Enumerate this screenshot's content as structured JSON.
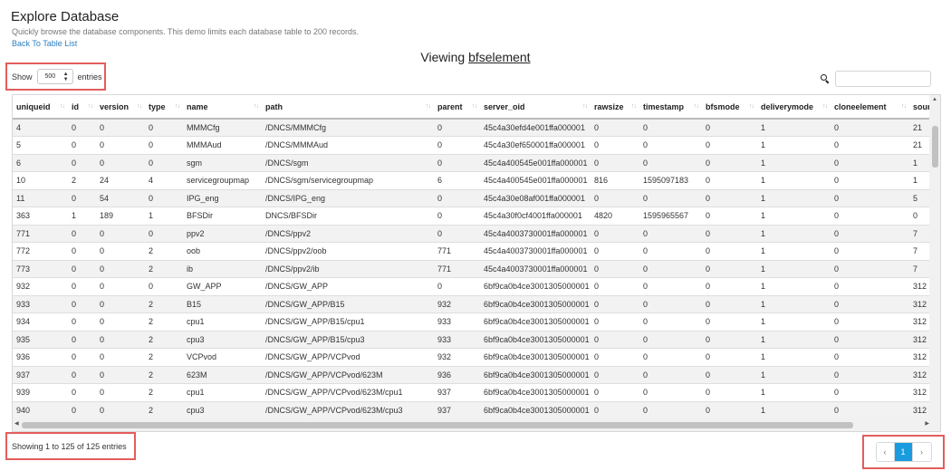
{
  "header": {
    "title": "Explore Database",
    "subtitle": "Quickly browse the database components. This demo limits each database table to 200 records.",
    "back_link": "Back To Table List"
  },
  "viewing": {
    "prefix": "Viewing",
    "table_name": "bfselement"
  },
  "length_control": {
    "show_label": "Show",
    "selected": "500",
    "entries_label": "entries"
  },
  "search": {
    "value": "",
    "placeholder": ""
  },
  "table": {
    "columns": [
      "uniqueid",
      "id",
      "version",
      "type",
      "name",
      "path",
      "parent",
      "server_oid",
      "rawsize",
      "timestamp",
      "bfsmode",
      "deliverymode",
      "cloneelement",
      "sourcei"
    ],
    "rows": [
      [
        "4",
        "0",
        "0",
        "0",
        "MMMCfg",
        "/DNCS/MMMCfg",
        "0",
        "45c4a30efd4e001ffa000001",
        "0",
        "0",
        "0",
        "1",
        "0",
        "21"
      ],
      [
        "5",
        "0",
        "0",
        "0",
        "MMMAud",
        "/DNCS/MMMAud",
        "0",
        "45c4a30ef650001ffa000001",
        "0",
        "0",
        "0",
        "1",
        "0",
        "21"
      ],
      [
        "6",
        "0",
        "0",
        "0",
        "sgm",
        "/DNCS/sgm",
        "0",
        "45c4a400545e001ffa000001",
        "0",
        "0",
        "0",
        "1",
        "0",
        "1"
      ],
      [
        "10",
        "2",
        "24",
        "4",
        "servicegroupmap",
        "/DNCS/sgm/servicegroupmap",
        "6",
        "45c4a400545e001ffa000001",
        "816",
        "1595097183",
        "0",
        "1",
        "0",
        "1"
      ],
      [
        "11",
        "0",
        "54",
        "0",
        "IPG_eng",
        "/DNCS/IPG_eng",
        "0",
        "45c4a30e08af001ffa000001",
        "0",
        "0",
        "0",
        "1",
        "0",
        "5"
      ],
      [
        "363",
        "1",
        "189",
        "1",
        "BFSDir",
        "DNCS/BFSDir",
        "0",
        "45c4a30f0cf4001ffa000001",
        "4820",
        "1595965567",
        "0",
        "1",
        "0",
        "0"
      ],
      [
        "771",
        "0",
        "0",
        "0",
        "ppv2",
        "/DNCS/ppv2",
        "0",
        "45c4a4003730001ffa000001",
        "0",
        "0",
        "0",
        "1",
        "0",
        "7"
      ],
      [
        "772",
        "0",
        "0",
        "2",
        "oob",
        "/DNCS/ppv2/oob",
        "771",
        "45c4a4003730001ffa000001",
        "0",
        "0",
        "0",
        "1",
        "0",
        "7"
      ],
      [
        "773",
        "0",
        "0",
        "2",
        "ib",
        "/DNCS/ppv2/ib",
        "771",
        "45c4a4003730001ffa000001",
        "0",
        "0",
        "0",
        "1",
        "0",
        "7"
      ],
      [
        "932",
        "0",
        "0",
        "0",
        "GW_APP",
        "/DNCS/GW_APP",
        "0",
        "6bf9ca0b4ce3001305000001",
        "0",
        "0",
        "0",
        "1",
        "0",
        "312"
      ],
      [
        "933",
        "0",
        "0",
        "2",
        "B15",
        "/DNCS/GW_APP/B15",
        "932",
        "6bf9ca0b4ce3001305000001",
        "0",
        "0",
        "0",
        "1",
        "0",
        "312"
      ],
      [
        "934",
        "0",
        "0",
        "2",
        "cpu1",
        "/DNCS/GW_APP/B15/cpu1",
        "933",
        "6bf9ca0b4ce3001305000001",
        "0",
        "0",
        "0",
        "1",
        "0",
        "312"
      ],
      [
        "935",
        "0",
        "0",
        "2",
        "cpu3",
        "/DNCS/GW_APP/B15/cpu3",
        "933",
        "6bf9ca0b4ce3001305000001",
        "0",
        "0",
        "0",
        "1",
        "0",
        "312"
      ],
      [
        "936",
        "0",
        "0",
        "2",
        "VCPvod",
        "/DNCS/GW_APP/VCPvod",
        "932",
        "6bf9ca0b4ce3001305000001",
        "0",
        "0",
        "0",
        "1",
        "0",
        "312"
      ],
      [
        "937",
        "0",
        "0",
        "2",
        "623M",
        "/DNCS/GW_APP/VCPvod/623M",
        "936",
        "6bf9ca0b4ce3001305000001",
        "0",
        "0",
        "0",
        "1",
        "0",
        "312"
      ],
      [
        "939",
        "0",
        "0",
        "2",
        "cpu1",
        "/DNCS/GW_APP/VCPvod/623M/cpu1",
        "937",
        "6bf9ca0b4ce3001305000001",
        "0",
        "0",
        "0",
        "1",
        "0",
        "312"
      ],
      [
        "940",
        "0",
        "0",
        "2",
        "cpu3",
        "/DNCS/GW_APP/VCPvod/623M/cpu3",
        "937",
        "6bf9ca0b4ce3001305000001",
        "0",
        "0",
        "0",
        "1",
        "0",
        "312"
      ]
    ]
  },
  "footer": {
    "info": "Showing 1 to 125 of 125 entries",
    "pagination": {
      "prev": "‹",
      "current": "1",
      "next": "›"
    }
  },
  "colors": {
    "accent": "#1a9be0",
    "link": "#2a7fc1",
    "highlight": "#e35d5d",
    "stripe": "#f2f2f2"
  },
  "icons": {
    "search": "search-icon",
    "sort": "sort-arrows-icon"
  }
}
